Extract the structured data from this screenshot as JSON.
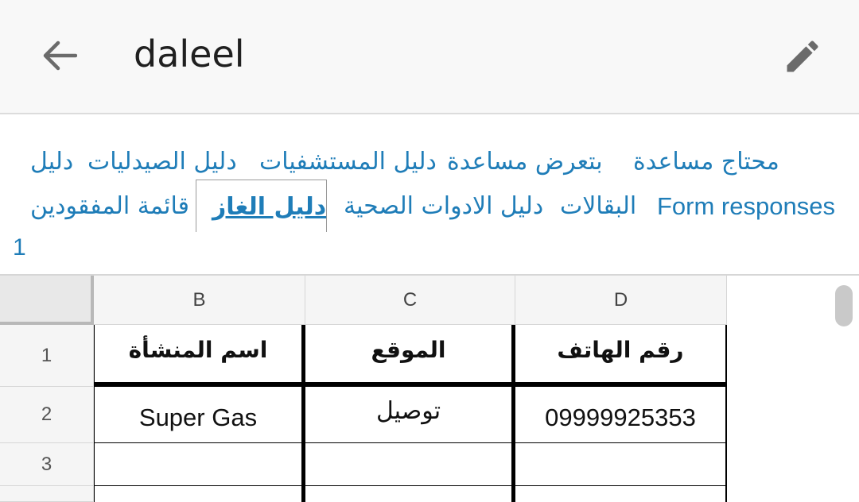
{
  "appbar": {
    "title": "daleel",
    "back_icon": "arrow-back-icon",
    "edit_icon": "pencil-icon"
  },
  "tabs": [
    {
      "label": "محتاج مساعدة"
    },
    {
      "label": "بتعرض مساعدة"
    },
    {
      "label": "دليل المستشفيات"
    },
    {
      "label": "دليل الصيدليات"
    },
    {
      "label": "دليل"
    },
    {
      "label": "Form responses"
    },
    {
      "label": "دليل الادوات الصحية"
    },
    {
      "label": "البقالات"
    },
    {
      "label": "دليل الغاز",
      "active": true
    },
    {
      "label": "قائمة المفقودين"
    },
    {
      "label": "1"
    }
  ],
  "grid": {
    "columns": [
      "B",
      "C",
      "D"
    ],
    "rows": [
      "1",
      "2",
      "3"
    ],
    "cells": [
      [
        "اسم المنشأة",
        "الموقع",
        "رقم الهاتف"
      ],
      [
        "Super Gas",
        "توصيل",
        "09999925353"
      ],
      [
        "",
        "",
        ""
      ]
    ]
  },
  "colors": {
    "tab_text": "#1f7db8",
    "header_bg": "#f5f5f5",
    "grid_line": "#d6d6d6"
  }
}
